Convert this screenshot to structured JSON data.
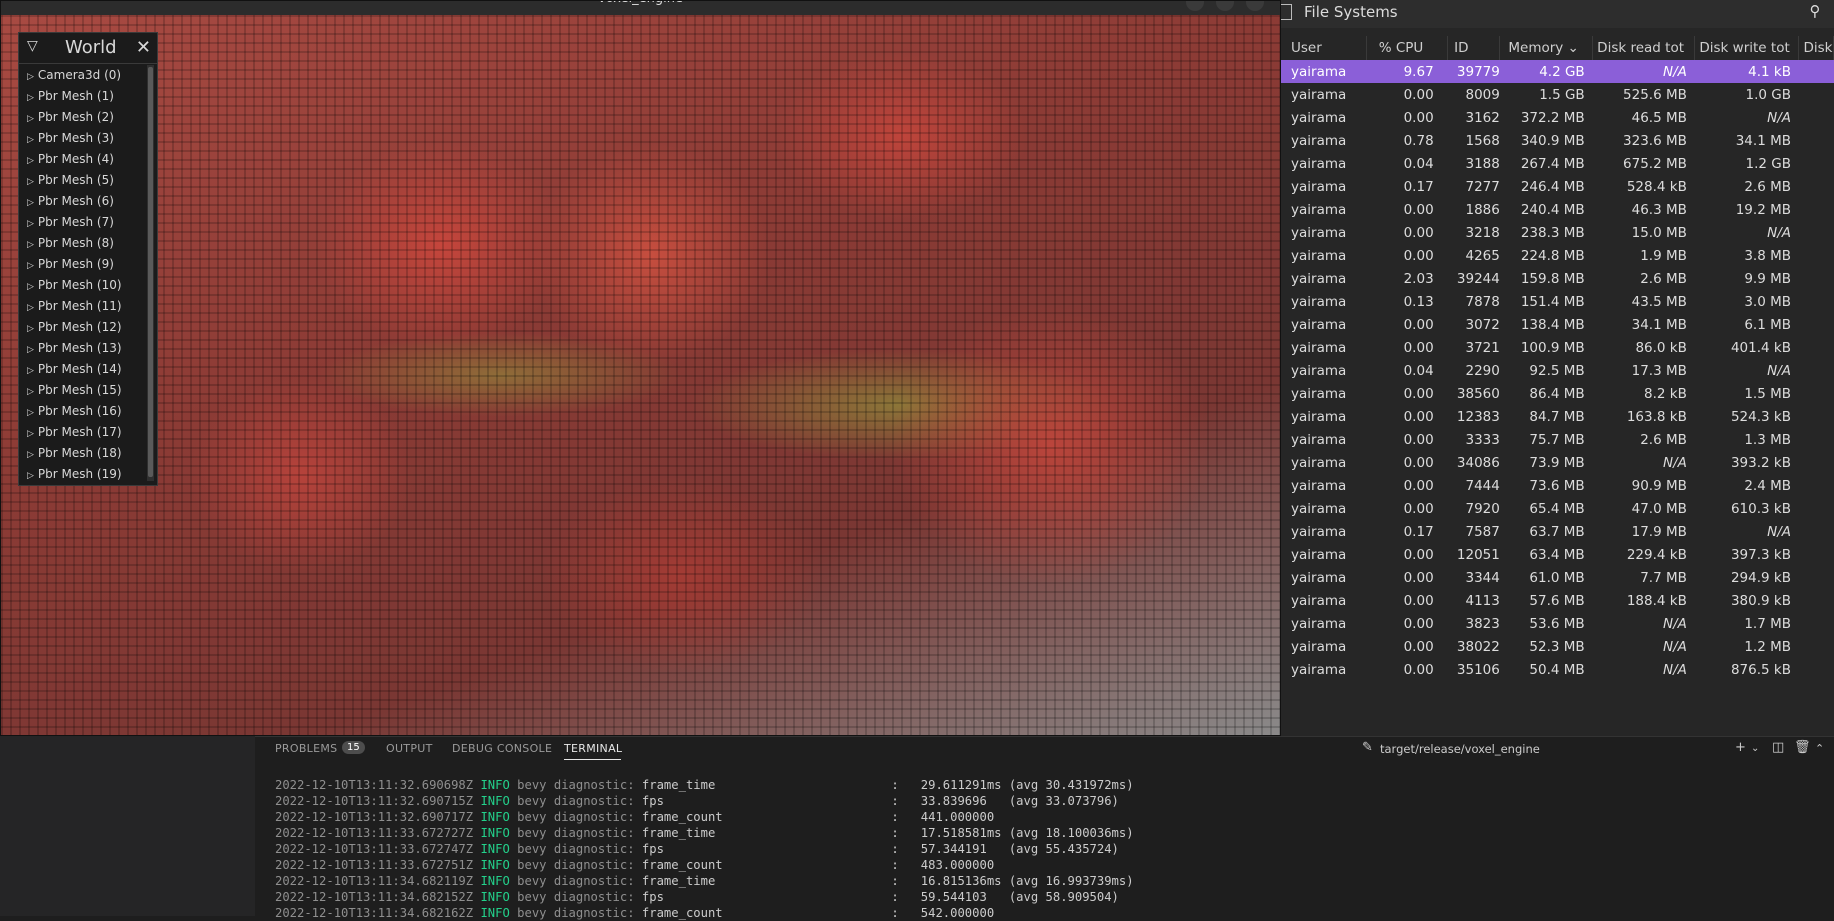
{
  "game": {
    "title": "voxel_engine",
    "world_panel": {
      "toggle": "▽",
      "title": "World",
      "close": "✕",
      "items": [
        "Camera3d (0)",
        "Pbr Mesh (1)",
        "Pbr Mesh (2)",
        "Pbr Mesh (3)",
        "Pbr Mesh (4)",
        "Pbr Mesh (5)",
        "Pbr Mesh (6)",
        "Pbr Mesh (7)",
        "Pbr Mesh (8)",
        "Pbr Mesh (9)",
        "Pbr Mesh (10)",
        "Pbr Mesh (11)",
        "Pbr Mesh (12)",
        "Pbr Mesh (13)",
        "Pbr Mesh (14)",
        "Pbr Mesh (15)",
        "Pbr Mesh (16)",
        "Pbr Mesh (17)",
        "Pbr Mesh (18)",
        "Pbr Mesh (19)"
      ]
    }
  },
  "sysmon": {
    "title": "File Systems",
    "search_icon": "search-icon",
    "columns": [
      "User",
      "% CPU",
      "ID",
      "Memory ⌄",
      "Disk read tot",
      "Disk write tot",
      "Disk"
    ],
    "rows": [
      [
        "yairama",
        "9.67",
        "39779",
        "4.2 GB",
        "N/A",
        "4.1 kB"
      ],
      [
        "yairama",
        "0.00",
        "8009",
        "1.5 GB",
        "525.6 MB",
        "1.0 GB"
      ],
      [
        "yairama",
        "0.00",
        "3162",
        "372.2 MB",
        "46.5 MB",
        "N/A"
      ],
      [
        "yairama",
        "0.78",
        "1568",
        "340.9 MB",
        "323.6 MB",
        "34.1 MB"
      ],
      [
        "yairama",
        "0.04",
        "3188",
        "267.4 MB",
        "675.2 MB",
        "1.2 GB"
      ],
      [
        "yairama",
        "0.17",
        "7277",
        "246.4 MB",
        "528.4 kB",
        "2.6 MB"
      ],
      [
        "yairama",
        "0.00",
        "1886",
        "240.4 MB",
        "46.3 MB",
        "19.2 MB"
      ],
      [
        "yairama",
        "0.00",
        "3218",
        "238.3 MB",
        "15.0 MB",
        "N/A"
      ],
      [
        "yairama",
        "0.00",
        "4265",
        "224.8 MB",
        "1.9 MB",
        "3.8 MB"
      ],
      [
        "yairama",
        "2.03",
        "39244",
        "159.8 MB",
        "2.6 MB",
        "9.9 MB"
      ],
      [
        "yairama",
        "0.13",
        "7878",
        "151.4 MB",
        "43.5 MB",
        "3.0 MB"
      ],
      [
        "yairama",
        "0.00",
        "3072",
        "138.4 MB",
        "34.1 MB",
        "6.1 MB"
      ],
      [
        "yairama",
        "0.00",
        "3721",
        "100.9 MB",
        "86.0 kB",
        "401.4 kB"
      ],
      [
        "yairama",
        "0.04",
        "2290",
        "92.5 MB",
        "17.3 MB",
        "N/A"
      ],
      [
        "yairama",
        "0.00",
        "38560",
        "86.4 MB",
        "8.2 kB",
        "1.5 MB"
      ],
      [
        "yairama",
        "0.00",
        "12383",
        "84.7 MB",
        "163.8 kB",
        "524.3 kB"
      ],
      [
        "yairama",
        "0.00",
        "3333",
        "75.7 MB",
        "2.6 MB",
        "1.3 MB"
      ],
      [
        "yairama",
        "0.00",
        "34086",
        "73.9 MB",
        "N/A",
        "393.2 kB"
      ],
      [
        "yairama",
        "0.00",
        "7444",
        "73.6 MB",
        "90.9 MB",
        "2.4 MB"
      ],
      [
        "yairama",
        "0.00",
        "7920",
        "65.4 MB",
        "47.0 MB",
        "610.3 kB"
      ],
      [
        "yairama",
        "0.17",
        "7587",
        "63.7 MB",
        "17.9 MB",
        "N/A"
      ],
      [
        "yairama",
        "0.00",
        "12051",
        "63.4 MB",
        "229.4 kB",
        "397.3 kB"
      ],
      [
        "yairama",
        "0.00",
        "3344",
        "61.0 MB",
        "7.7 MB",
        "294.9 kB"
      ],
      [
        "yairama",
        "0.00",
        "4113",
        "57.6 MB",
        "188.4 kB",
        "380.9 kB"
      ],
      [
        "yairama",
        "0.00",
        "3823",
        "53.6 MB",
        "N/A",
        "1.7 MB"
      ],
      [
        "yairama",
        "0.00",
        "38022",
        "52.3 MB",
        "N/A",
        "1.2 MB"
      ],
      [
        "yairama",
        "0.00",
        "35106",
        "50.4 MB",
        "N/A",
        "876.5 kB"
      ]
    ]
  },
  "terminal": {
    "tabs": {
      "problems": "PROBLEMS",
      "problems_count": "15",
      "output": "OUTPUT",
      "debug": "DEBUG CONSOLE",
      "terminal": "TERMINAL"
    },
    "task": "target/release/voxel_engine",
    "lines": [
      {
        "ts": "2022-12-10T13:11:32.690698Z",
        "lvl": "INFO",
        "src": "bevy diagnostic:",
        "key": "frame_time  ",
        "val": "29.611291ms (avg 30.431972ms)"
      },
      {
        "ts": "2022-12-10T13:11:32.690715Z",
        "lvl": "INFO",
        "src": "bevy diagnostic:",
        "key": "fps         ",
        "val": "33.839696   (avg 33.073796)"
      },
      {
        "ts": "2022-12-10T13:11:32.690717Z",
        "lvl": "INFO",
        "src": "bevy diagnostic:",
        "key": "frame_count ",
        "val": "441.000000"
      },
      {
        "ts": "2022-12-10T13:11:33.672727Z",
        "lvl": "INFO",
        "src": "bevy diagnostic:",
        "key": "frame_time  ",
        "val": "17.518581ms (avg 18.100036ms)"
      },
      {
        "ts": "2022-12-10T13:11:33.672747Z",
        "lvl": "INFO",
        "src": "bevy diagnostic:",
        "key": "fps         ",
        "val": "57.344191   (avg 55.435724)"
      },
      {
        "ts": "2022-12-10T13:11:33.672751Z",
        "lvl": "INFO",
        "src": "bevy diagnostic:",
        "key": "frame_count ",
        "val": "483.000000"
      },
      {
        "ts": "2022-12-10T13:11:34.682119Z",
        "lvl": "INFO",
        "src": "bevy diagnostic:",
        "key": "frame_time  ",
        "val": "16.815136ms (avg 16.993739ms)"
      },
      {
        "ts": "2022-12-10T13:11:34.682152Z",
        "lvl": "INFO",
        "src": "bevy diagnostic:",
        "key": "fps         ",
        "val": "59.544103   (avg 58.909504)"
      },
      {
        "ts": "2022-12-10T13:11:34.682162Z",
        "lvl": "INFO",
        "src": "bevy diagnostic:",
        "key": "frame_count ",
        "val": "542.000000"
      }
    ],
    "separator": ":"
  }
}
